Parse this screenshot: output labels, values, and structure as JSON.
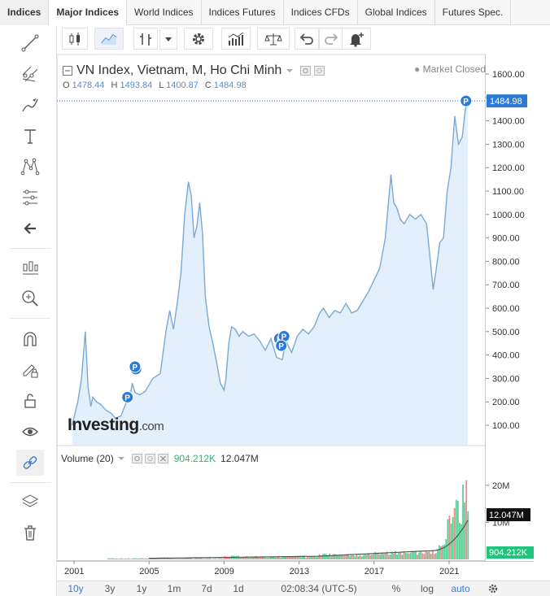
{
  "tabs": [
    "Indices",
    "Major Indices",
    "World Indices",
    "Indices Futures",
    "Indices CFDs",
    "Global Indices",
    "Futures Spec."
  ],
  "left_toolbar": [
    "trend-line-icon",
    "pitchfork-icon",
    "brush-icon",
    "text-icon",
    "pattern-icon",
    "fib-icon",
    "back-arrow-icon",
    "ohlc-icon",
    "zoom-icon",
    "magnet-icon",
    "lock-pencil-icon",
    "unlock-icon",
    "eye-icon",
    "link-icon",
    "layers-icon",
    "trash-icon"
  ],
  "top_toolbar": [
    "candles-icon",
    "line-chart-icon",
    "bars-icon",
    "dropdown-icon",
    "settings-icon",
    "indicators-icon",
    "compare-icon",
    "undo-icon",
    "redo-icon",
    "alert-icon"
  ],
  "legend": {
    "title": "VN Index, Vietnam, M, Ho Chi Minh",
    "market_status": "Market Closed",
    "o_label": "O",
    "o_value": "1478.44",
    "h_label": "H",
    "h_value": "1493.84",
    "l_label": "L",
    "l_value": "1400.87",
    "c_label": "C",
    "c_value": "1484.98"
  },
  "watermark": "Investing",
  "watermark_suffix": ".com",
  "volume_legend": {
    "label": "Volume (20)",
    "value1": "904.212K",
    "value2": "12.047M"
  },
  "colors": {
    "line": "#7aa9d8",
    "area": "#e3f0fb",
    "accent": "#2a7ad6",
    "up": "#5ccf98",
    "down": "#f08a8a",
    "ma": "#555555"
  },
  "chart_data": {
    "type": "area",
    "title": "VN Index, Vietnam, M, Ho Chi Minh",
    "last_price_label": "1484.98",
    "y_ticks": [
      "1600.00",
      "1500.00",
      "1400.00",
      "1300.00",
      "1200.00",
      "1100.00",
      "1000.00",
      "900.00",
      "800.00",
      "700.00",
      "600.00",
      "500.00",
      "400.00",
      "300.00",
      "200.00",
      "100.00"
    ],
    "ylim": [
      0,
      1600
    ],
    "x_ticks": [
      "2001",
      "2005",
      "2009",
      "2013",
      "2017",
      "2021"
    ],
    "xlim": [
      2000.6,
      2022.4
    ],
    "x": [
      2000.9,
      2001.2,
      2001.4,
      2001.6,
      2001.75,
      2001.9,
      2002.0,
      2002.2,
      2002.4,
      2002.7,
      2003.0,
      2003.2,
      2003.5,
      2003.8,
      2004.0,
      2004.1,
      2004.25,
      2004.5,
      2004.8,
      2005.2,
      2005.6,
      2005.9,
      2006.1,
      2006.3,
      2006.5,
      2006.7,
      2006.9,
      2007.1,
      2007.25,
      2007.4,
      2007.55,
      2007.7,
      2007.85,
      2008.0,
      2008.2,
      2008.4,
      2008.6,
      2008.8,
      2009.0,
      2009.1,
      2009.25,
      2009.4,
      2009.6,
      2009.8,
      2010.0,
      2010.3,
      2010.6,
      2010.9,
      2011.2,
      2011.5,
      2011.8,
      2012.1,
      2012.3,
      2012.6,
      2012.9,
      2013.2,
      2013.5,
      2013.8,
      2014.1,
      2014.3,
      2014.6,
      2014.9,
      2015.2,
      2015.5,
      2015.8,
      2016.1,
      2016.4,
      2016.7,
      2017.0,
      2017.3,
      2017.6,
      2017.9,
      2018.05,
      2018.2,
      2018.4,
      2018.6,
      2018.9,
      2019.2,
      2019.5,
      2019.8,
      2020.0,
      2020.15,
      2020.3,
      2020.5,
      2020.7,
      2020.9,
      2021.1,
      2021.3,
      2021.5,
      2021.7,
      2021.85,
      2022.0
    ],
    "y": [
      100,
      200,
      300,
      500,
      260,
      180,
      220,
      200,
      190,
      165,
      150,
      130,
      140,
      200,
      230,
      280,
      240,
      230,
      245,
      300,
      320,
      500,
      590,
      510,
      620,
      750,
      1000,
      1140,
      1080,
      900,
      950,
      1050,
      920,
      650,
      520,
      450,
      370,
      280,
      250,
      300,
      450,
      520,
      510,
      480,
      500,
      480,
      490,
      460,
      420,
      470,
      390,
      380,
      460,
      410,
      480,
      510,
      490,
      520,
      580,
      600,
      560,
      590,
      580,
      620,
      580,
      590,
      630,
      670,
      720,
      770,
      900,
      1170,
      1050,
      1030,
      980,
      960,
      1000,
      980,
      1000,
      960,
      800,
      680,
      760,
      880,
      900,
      1100,
      1200,
      1420,
      1300,
      1330,
      1440,
      1500
    ],
    "volume": {
      "y_ticks": [
        "20M",
        "10M"
      ],
      "ylim": [
        0,
        25
      ],
      "unit": "M"
    }
  },
  "bottom_bar": {
    "ranges": [
      "10y",
      "3y",
      "1y",
      "1m",
      "7d",
      "1d"
    ],
    "time": "02:08:34 (UTC-5)",
    "percent": "%",
    "log": "log",
    "auto": "auto"
  }
}
